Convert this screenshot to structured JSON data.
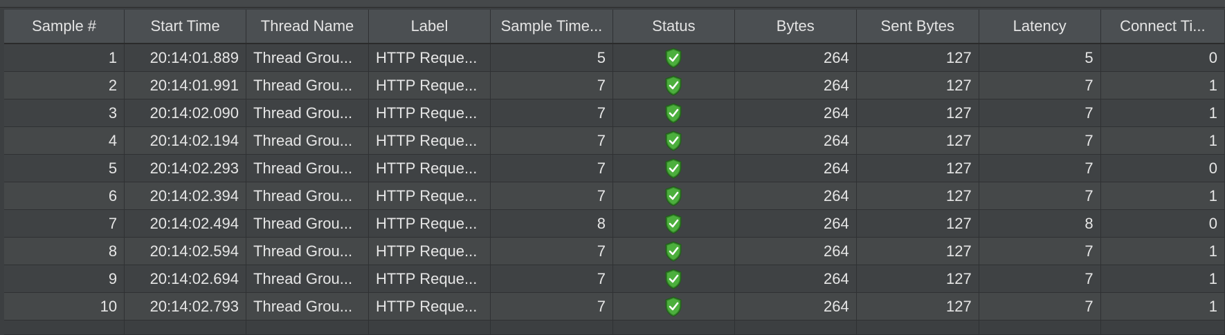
{
  "table": {
    "columns": [
      "Sample #",
      "Start Time",
      "Thread Name",
      "Label",
      "Sample Time...",
      "Status",
      "Bytes",
      "Sent Bytes",
      "Latency",
      "Connect Ti..."
    ],
    "rows": [
      {
        "sample": "1",
        "start_time": "20:14:01.889",
        "thread_name": "Thread Grou...",
        "label": "HTTP Reque...",
        "sample_time": "5",
        "status": "success",
        "bytes": "264",
        "sent_bytes": "127",
        "latency": "5",
        "connect_time": "0"
      },
      {
        "sample": "2",
        "start_time": "20:14:01.991",
        "thread_name": "Thread Grou...",
        "label": "HTTP Reque...",
        "sample_time": "7",
        "status": "success",
        "bytes": "264",
        "sent_bytes": "127",
        "latency": "7",
        "connect_time": "1"
      },
      {
        "sample": "3",
        "start_time": "20:14:02.090",
        "thread_name": "Thread Grou...",
        "label": "HTTP Reque...",
        "sample_time": "7",
        "status": "success",
        "bytes": "264",
        "sent_bytes": "127",
        "latency": "7",
        "connect_time": "1"
      },
      {
        "sample": "4",
        "start_time": "20:14:02.194",
        "thread_name": "Thread Grou...",
        "label": "HTTP Reque...",
        "sample_time": "7",
        "status": "success",
        "bytes": "264",
        "sent_bytes": "127",
        "latency": "7",
        "connect_time": "1"
      },
      {
        "sample": "5",
        "start_time": "20:14:02.293",
        "thread_name": "Thread Grou...",
        "label": "HTTP Reque...",
        "sample_time": "7",
        "status": "success",
        "bytes": "264",
        "sent_bytes": "127",
        "latency": "7",
        "connect_time": "0"
      },
      {
        "sample": "6",
        "start_time": "20:14:02.394",
        "thread_name": "Thread Grou...",
        "label": "HTTP Reque...",
        "sample_time": "7",
        "status": "success",
        "bytes": "264",
        "sent_bytes": "127",
        "latency": "7",
        "connect_time": "1"
      },
      {
        "sample": "7",
        "start_time": "20:14:02.494",
        "thread_name": "Thread Grou...",
        "label": "HTTP Reque...",
        "sample_time": "8",
        "status": "success",
        "bytes": "264",
        "sent_bytes": "127",
        "latency": "8",
        "connect_time": "0"
      },
      {
        "sample": "8",
        "start_time": "20:14:02.594",
        "thread_name": "Thread Grou...",
        "label": "HTTP Reque...",
        "sample_time": "7",
        "status": "success",
        "bytes": "264",
        "sent_bytes": "127",
        "latency": "7",
        "connect_time": "1"
      },
      {
        "sample": "9",
        "start_time": "20:14:02.694",
        "thread_name": "Thread Grou...",
        "label": "HTTP Reque...",
        "sample_time": "7",
        "status": "success",
        "bytes": "264",
        "sent_bytes": "127",
        "latency": "7",
        "connect_time": "1"
      },
      {
        "sample": "10",
        "start_time": "20:14:02.793",
        "thread_name": "Thread Grou...",
        "label": "HTTP Reque...",
        "sample_time": "7",
        "status": "success",
        "bytes": "264",
        "sent_bytes": "127",
        "latency": "7",
        "connect_time": "1"
      }
    ]
  },
  "status_icon": "shield-check-icon",
  "colors": {
    "background": "#3c3f41",
    "header": "#4b4f52",
    "success": "#4caf3d"
  }
}
